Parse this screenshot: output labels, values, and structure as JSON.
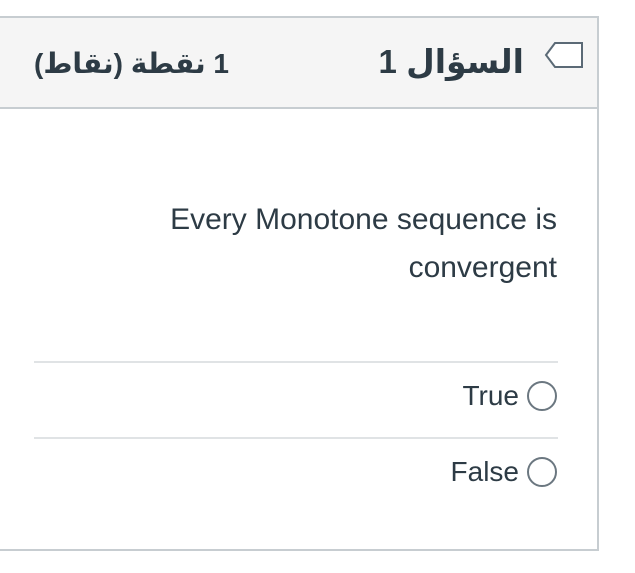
{
  "question": {
    "title": "السؤال 1",
    "points": "1 نقطة (نقاط)",
    "text": "Every Monotone sequence is convergent",
    "icons": {
      "flag": "flag-icon"
    },
    "answers": [
      {
        "label": "True",
        "selected": false
      },
      {
        "label": "False",
        "selected": false
      }
    ]
  },
  "colors": {
    "header_background": "#f5f5f5",
    "border": "#c7cdd1",
    "text": "#2d3b45"
  }
}
